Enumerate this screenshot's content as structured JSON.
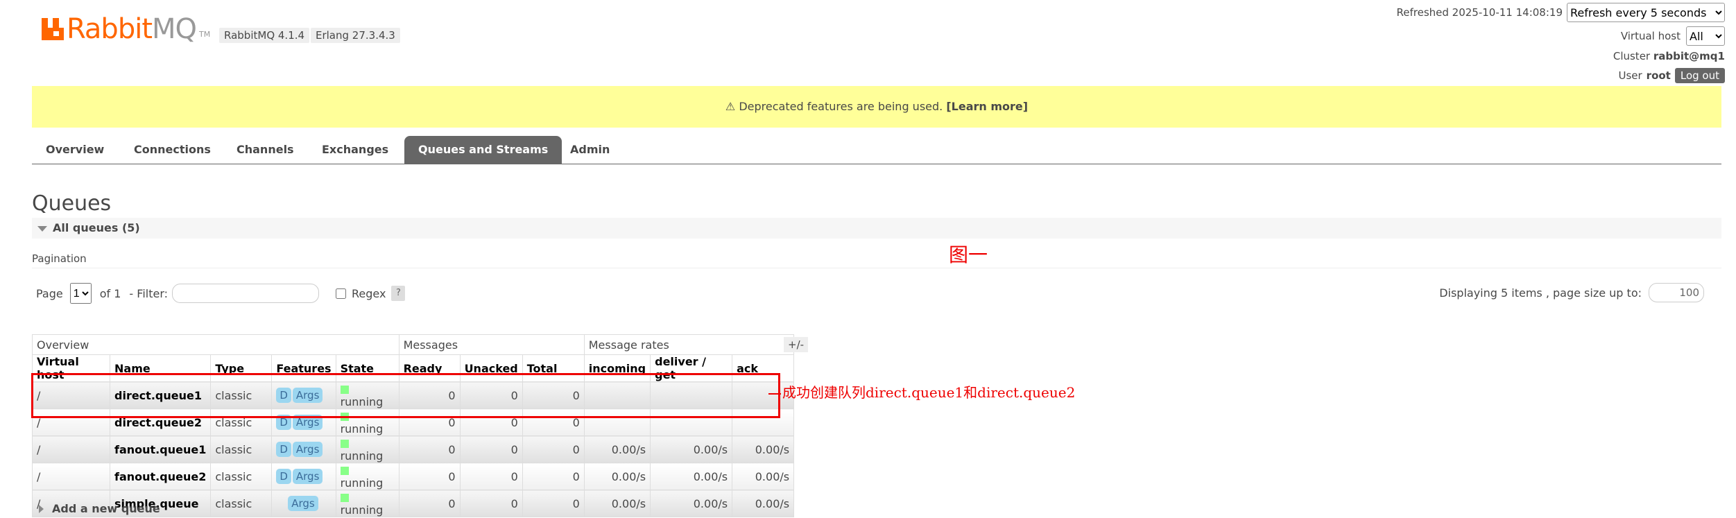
{
  "header": {
    "logo": {
      "rabbit": "Rabbit",
      "mq": "MQ",
      "tm": "TM"
    },
    "version": "RabbitMQ 4.1.4",
    "erlang": "Erlang 27.3.4.3",
    "refreshed": "Refreshed 2025-10-11 14:08:19",
    "refresh_option": "Refresh every 5 seconds",
    "vhost_label": "Virtual host",
    "vhost_value": "All",
    "cluster_label": "Cluster",
    "cluster_value": "rabbit@mq1",
    "user_label": "User",
    "user_value": "root",
    "logout": "Log out"
  },
  "banner": {
    "text": "⚠ Deprecated features are being used.",
    "link": "[Learn more]"
  },
  "tabs": [
    "Overview",
    "Connections",
    "Channels",
    "Exchanges",
    "Queues and Streams",
    "Admin"
  ],
  "active_tab": "Queues and Streams",
  "page_title": "Queues",
  "section_title": "All queues (5)",
  "pagination": {
    "label": "Pagination",
    "page_label": "Page",
    "page_value": "1",
    "of_label": "of 1",
    "filter_label": "- Filter:",
    "filter_value": "",
    "regex_label": "Regex",
    "help": "?",
    "display_text": "Displaying 5 items , page size up to:",
    "page_size": "100"
  },
  "table": {
    "groups": [
      "Overview",
      "Messages",
      "Message rates"
    ],
    "columns": [
      "Virtual host",
      "Name",
      "Type",
      "Features",
      "State",
      "Ready",
      "Unacked",
      "Total",
      "incoming",
      "deliver / get",
      "ack"
    ],
    "toggle": "+/-",
    "rows": [
      {
        "vhost": "/",
        "name": "direct.queue1",
        "type": "classic",
        "features": [
          "D",
          "Args"
        ],
        "state": "running",
        "ready": "0",
        "unacked": "0",
        "total": "0",
        "incoming": "",
        "deliver": "",
        "ack": ""
      },
      {
        "vhost": "/",
        "name": "direct.queue2",
        "type": "classic",
        "features": [
          "D",
          "Args"
        ],
        "state": "running",
        "ready": "0",
        "unacked": "0",
        "total": "0",
        "incoming": "",
        "deliver": "",
        "ack": ""
      },
      {
        "vhost": "/",
        "name": "fanout.queue1",
        "type": "classic",
        "features": [
          "D",
          "Args"
        ],
        "state": "running",
        "ready": "0",
        "unacked": "0",
        "total": "0",
        "incoming": "0.00/s",
        "deliver": "0.00/s",
        "ack": "0.00/s"
      },
      {
        "vhost": "/",
        "name": "fanout.queue2",
        "type": "classic",
        "features": [
          "D",
          "Args"
        ],
        "state": "running",
        "ready": "0",
        "unacked": "0",
        "total": "0",
        "incoming": "0.00/s",
        "deliver": "0.00/s",
        "ack": "0.00/s"
      },
      {
        "vhost": "/",
        "name": "simple.queue",
        "type": "classic",
        "features": [
          "Args"
        ],
        "state": "running",
        "ready": "0",
        "unacked": "0",
        "total": "0",
        "incoming": "0.00/s",
        "deliver": "0.00/s",
        "ack": "0.00/s"
      }
    ]
  },
  "annotations": {
    "figure": "图一",
    "note": "成功创建队列direct.queue1和direct.queue2"
  },
  "add_queue": "Add a new queue",
  "colors": {
    "brand_orange": "#ff6600",
    "annotation_red": "#ee0000",
    "banner_yellow": "#ffff99",
    "active_tab": "#666666",
    "running_green": "#88ff88",
    "badge_blue": "#9bd6f0"
  }
}
